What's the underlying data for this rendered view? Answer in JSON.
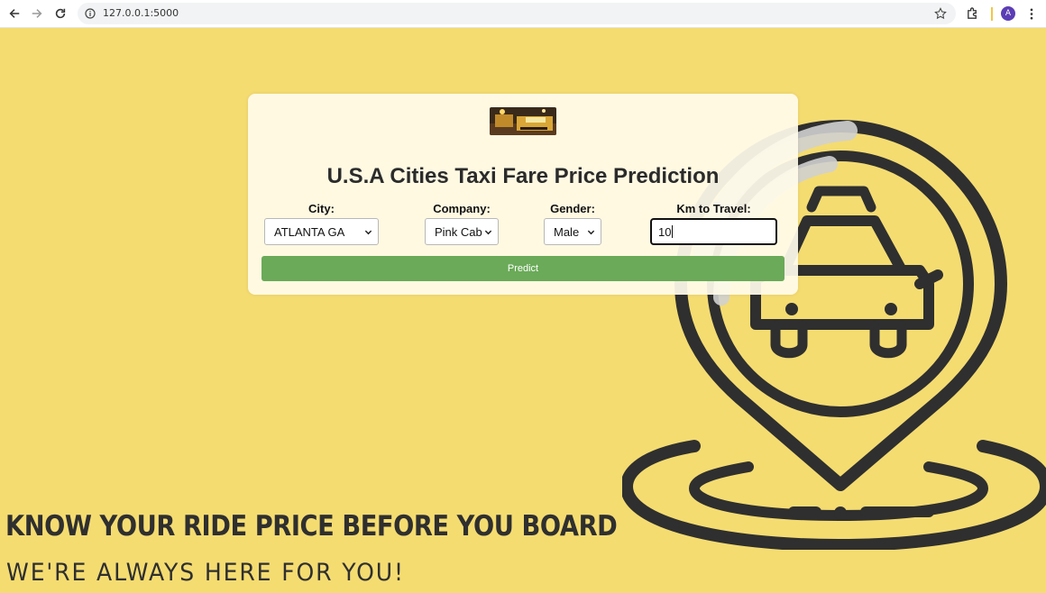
{
  "browser": {
    "url": "127.0.0.1:5000",
    "avatar_letter": "A"
  },
  "form": {
    "title": "U.S.A Cities Taxi Fare Price Prediction",
    "city_label": "City:",
    "city_value": "ATLANTA GA",
    "company_label": "Company:",
    "company_value": "Pink Cab",
    "gender_label": "Gender:",
    "gender_value": "Male",
    "km_label": "Km to Travel:",
    "km_value": "10",
    "predict_label": "Predict"
  },
  "taglines": {
    "main": "KNOW YOUR RIDE PRICE BEFORE YOU BOARD",
    "sub": "WE'RE ALWAYS HERE FOR YOU!"
  },
  "colors": {
    "background": "#f4dc71",
    "button": "#6aaa58",
    "illustration": "#2f2f2f"
  },
  "icons": [
    "back-arrow-icon",
    "forward-arrow-icon",
    "reload-icon",
    "info-icon",
    "star-icon",
    "extensions-icon",
    "kebab-menu-icon",
    "taxi-location-pin-icon"
  ]
}
